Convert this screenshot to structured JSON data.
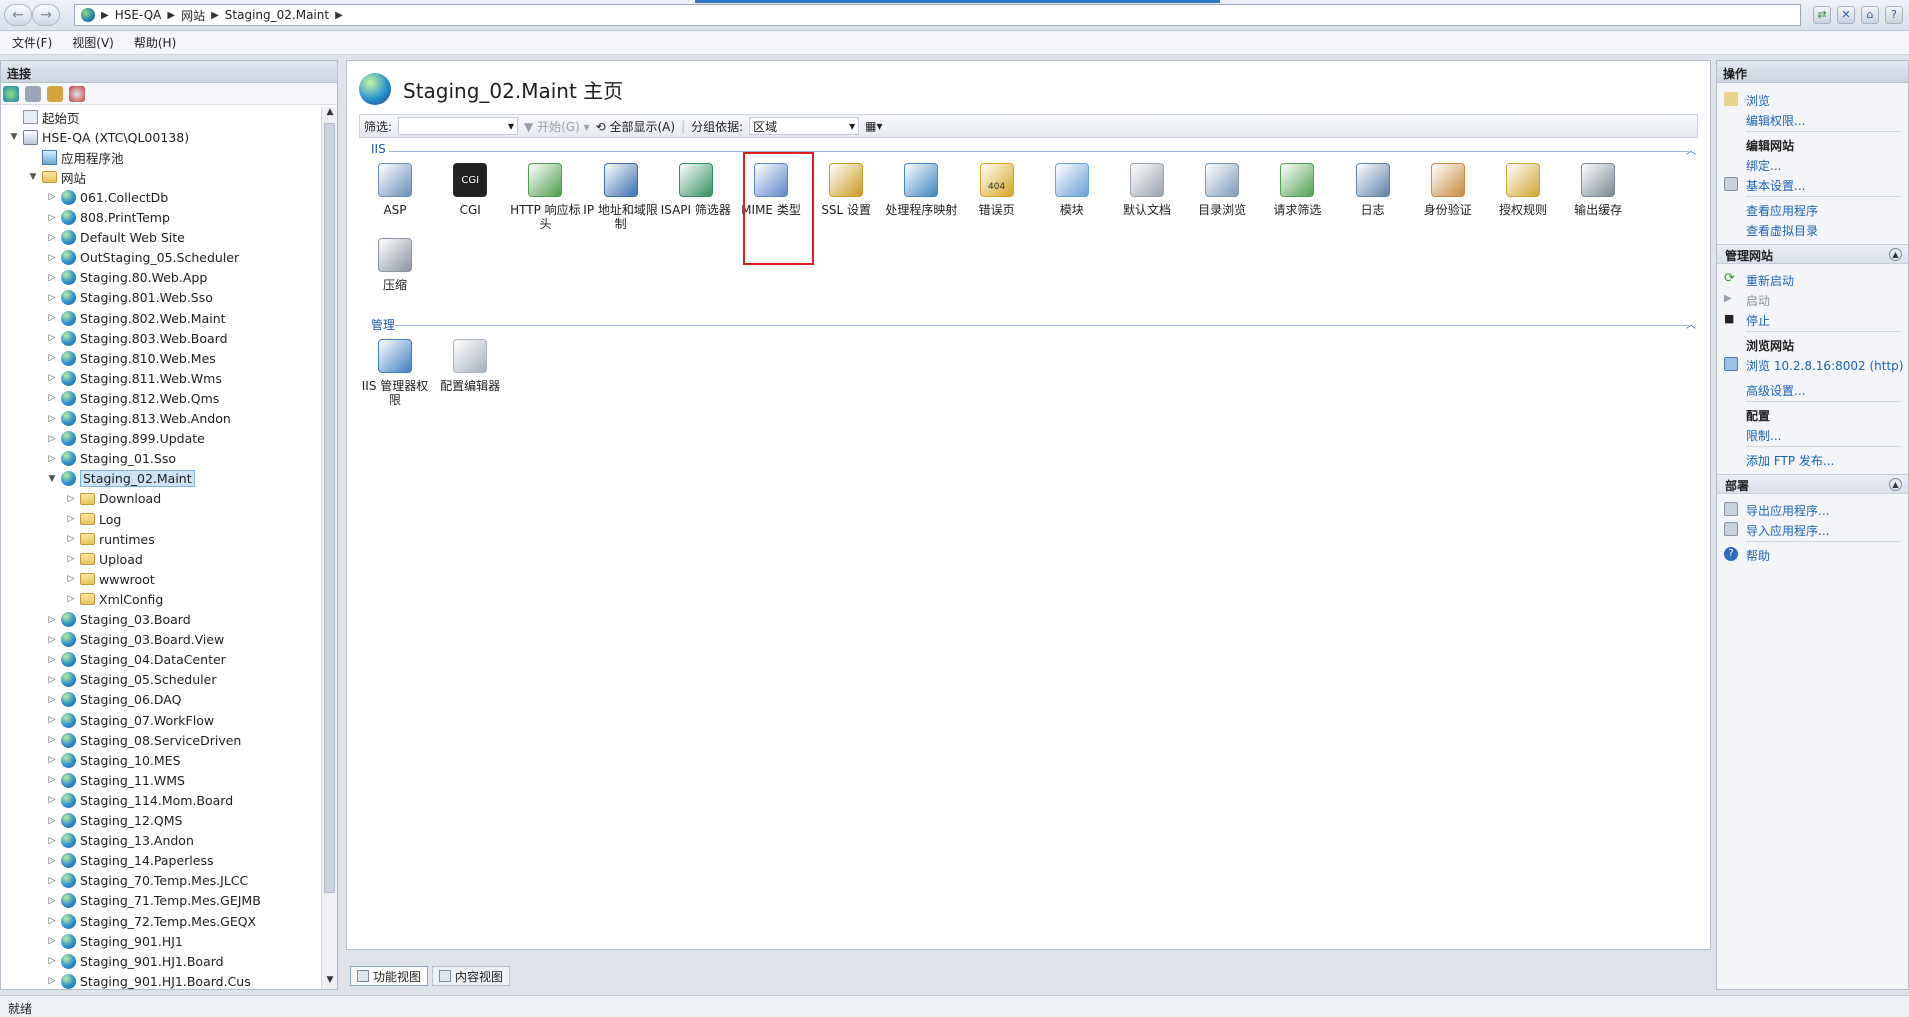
{
  "address": {
    "crumbs": [
      "HSE-QA",
      "网站",
      "Staging_02.Maint"
    ]
  },
  "menu": [
    "文件(F)",
    "视图(V)",
    "帮助(H)"
  ],
  "left": {
    "title": "连接",
    "tree": [
      {
        "label": "起始页",
        "indent": 0,
        "icon": "home",
        "tw": ""
      },
      {
        "label": "HSE-QA (XTC\\QL00138)",
        "indent": 0,
        "icon": "server",
        "tw": "▼"
      },
      {
        "label": "应用程序池",
        "indent": 1,
        "icon": "pool",
        "tw": ""
      },
      {
        "label": "网站",
        "indent": 1,
        "icon": "folder",
        "tw": "▼"
      },
      {
        "label": "061.CollectDb",
        "indent": 2,
        "icon": "globe",
        "tw": "▷"
      },
      {
        "label": "808.PrintTemp",
        "indent": 2,
        "icon": "globe",
        "tw": "▷"
      },
      {
        "label": "Default Web Site",
        "indent": 2,
        "icon": "globe",
        "tw": "▷"
      },
      {
        "label": "OutStaging_05.Scheduler",
        "indent": 2,
        "icon": "globe",
        "tw": "▷"
      },
      {
        "label": "Staging.80.Web.App",
        "indent": 2,
        "icon": "globe",
        "tw": "▷"
      },
      {
        "label": "Staging.801.Web.Sso",
        "indent": 2,
        "icon": "globe",
        "tw": "▷"
      },
      {
        "label": "Staging.802.Web.Maint",
        "indent": 2,
        "icon": "globe",
        "tw": "▷"
      },
      {
        "label": "Staging.803.Web.Board",
        "indent": 2,
        "icon": "globe",
        "tw": "▷"
      },
      {
        "label": "Staging.810.Web.Mes",
        "indent": 2,
        "icon": "globe",
        "tw": "▷"
      },
      {
        "label": "Staging.811.Web.Wms",
        "indent": 2,
        "icon": "globe",
        "tw": "▷"
      },
      {
        "label": "Staging.812.Web.Qms",
        "indent": 2,
        "icon": "globe",
        "tw": "▷"
      },
      {
        "label": "Staging.813.Web.Andon",
        "indent": 2,
        "icon": "globe",
        "tw": "▷"
      },
      {
        "label": "Staging.899.Update",
        "indent": 2,
        "icon": "globe",
        "tw": "▷"
      },
      {
        "label": "Staging_01.Sso",
        "indent": 2,
        "icon": "globe",
        "tw": "▷"
      },
      {
        "label": "Staging_02.Maint",
        "indent": 2,
        "icon": "globe",
        "tw": "▼",
        "selected": true
      },
      {
        "label": "Download",
        "indent": 3,
        "icon": "folder",
        "tw": "▷"
      },
      {
        "label": "Log",
        "indent": 3,
        "icon": "folder",
        "tw": "▷"
      },
      {
        "label": "runtimes",
        "indent": 3,
        "icon": "folder",
        "tw": "▷"
      },
      {
        "label": "Upload",
        "indent": 3,
        "icon": "folder",
        "tw": "▷"
      },
      {
        "label": "wwwroot",
        "indent": 3,
        "icon": "folder",
        "tw": "▷"
      },
      {
        "label": "XmlConfig",
        "indent": 3,
        "icon": "folder",
        "tw": "▷"
      },
      {
        "label": "Staging_03.Board",
        "indent": 2,
        "icon": "globe",
        "tw": "▷"
      },
      {
        "label": "Staging_03.Board.View",
        "indent": 2,
        "icon": "globe",
        "tw": "▷"
      },
      {
        "label": "Staging_04.DataCenter",
        "indent": 2,
        "icon": "globe",
        "tw": "▷"
      },
      {
        "label": "Staging_05.Scheduler",
        "indent": 2,
        "icon": "globe",
        "tw": "▷"
      },
      {
        "label": "Staging_06.DAQ",
        "indent": 2,
        "icon": "globe",
        "tw": "▷"
      },
      {
        "label": "Staging_07.WorkFlow",
        "indent": 2,
        "icon": "globe",
        "tw": "▷"
      },
      {
        "label": "Staging_08.ServiceDriven",
        "indent": 2,
        "icon": "globe",
        "tw": "▷"
      },
      {
        "label": "Staging_10.MES",
        "indent": 2,
        "icon": "globe",
        "tw": "▷"
      },
      {
        "label": "Staging_11.WMS",
        "indent": 2,
        "icon": "globe",
        "tw": "▷"
      },
      {
        "label": "Staging_114.Mom.Board",
        "indent": 2,
        "icon": "globe",
        "tw": "▷"
      },
      {
        "label": "Staging_12.QMS",
        "indent": 2,
        "icon": "globe",
        "tw": "▷"
      },
      {
        "label": "Staging_13.Andon",
        "indent": 2,
        "icon": "globe",
        "tw": "▷"
      },
      {
        "label": "Staging_14.Paperless",
        "indent": 2,
        "icon": "globe",
        "tw": "▷"
      },
      {
        "label": "Staging_70.Temp.Mes.JLCC",
        "indent": 2,
        "icon": "globe",
        "tw": "▷"
      },
      {
        "label": "Staging_71.Temp.Mes.GEJMB",
        "indent": 2,
        "icon": "globe",
        "tw": "▷"
      },
      {
        "label": "Staging_72.Temp.Mes.GEQX",
        "indent": 2,
        "icon": "globe",
        "tw": "▷"
      },
      {
        "label": "Staging_901.HJ1",
        "indent": 2,
        "icon": "globe",
        "tw": "▷"
      },
      {
        "label": "Staging_901.HJ1.Board",
        "indent": 2,
        "icon": "globe",
        "tw": "▷"
      },
      {
        "label": "Staging_901.HJ1.Board.Cus",
        "indent": 2,
        "icon": "globe",
        "tw": "▷"
      }
    ]
  },
  "center": {
    "title": "Staging_02.Maint 主页",
    "filter_label": "筛选:",
    "start_label": "开始(G)",
    "show_all_label": "全部显示(A)",
    "group_label": "分组依据:",
    "group_value": "区域",
    "iis_section": "IIS",
    "mgmt_section": "管理",
    "iis_features": [
      {
        "label": "ASP",
        "icon": "asp-icon",
        "color": "#6b8fb8"
      },
      {
        "label": "CGI",
        "icon": "cgi-icon",
        "color": "#2a2a2a"
      },
      {
        "label": "HTTP 响应标头",
        "icon": "http-headers-icon",
        "color": "#4f9e4f"
      },
      {
        "label": "IP 地址和域限制",
        "icon": "ip-restrictions-icon",
        "color": "#3a6fb0"
      },
      {
        "label": "ISAPI 筛选器",
        "icon": "isapi-filters-icon",
        "color": "#2f8f63"
      },
      {
        "label": "MIME 类型",
        "icon": "mime-types-icon",
        "color": "#5c86c9"
      },
      {
        "label": "SSL 设置",
        "icon": "ssl-lock-icon",
        "color": "#c99a1f"
      },
      {
        "label": "处理程序映射",
        "icon": "handler-mappings-icon",
        "color": "#3f86c2"
      },
      {
        "label": "错误页",
        "icon": "error-pages-icon",
        "color": "#d7a51e"
      },
      {
        "label": "模块",
        "icon": "modules-icon",
        "color": "#6aa0d6"
      },
      {
        "label": "默认文档",
        "icon": "default-document-icon",
        "color": "#9aa3ae"
      },
      {
        "label": "目录浏览",
        "icon": "directory-browsing-icon",
        "color": "#7f9bb8"
      },
      {
        "label": "请求筛选",
        "icon": "request-filtering-icon",
        "color": "#4fa04f"
      },
      {
        "label": "日志",
        "icon": "logging-icon",
        "color": "#5f7fa8"
      },
      {
        "label": "身份验证",
        "icon": "authentication-icon",
        "color": "#c98a3e"
      },
      {
        "label": "授权规则",
        "icon": "authorization-rules-icon",
        "color": "#d1a533"
      },
      {
        "label": "输出缓存",
        "icon": "output-caching-icon",
        "color": "#7a8796"
      },
      {
        "label": "压缩",
        "icon": "compression-icon",
        "color": "#8a94a0"
      }
    ],
    "mgmt_features": [
      {
        "label": "IIS 管理器权限",
        "icon": "iis-manager-permissions-icon",
        "color": "#3e7fc1"
      },
      {
        "label": "配置编辑器",
        "icon": "configuration-editor-icon",
        "color": "#a7b1bd"
      }
    ],
    "tabs": [
      "功能视图",
      "内容视图"
    ]
  },
  "right": {
    "title": "操作",
    "browse": "浏览",
    "edit_perms": "编辑权限...",
    "edit_site_header": "编辑网站",
    "bindings": "绑定...",
    "basic_settings": "基本设置...",
    "view_apps": "查看应用程序",
    "view_vdirs": "查看虚拟目录",
    "manage_site_header": "管理网站",
    "restart": "重新启动",
    "start": "启动",
    "stop": "停止",
    "browse_site_header": "浏览网站",
    "browse_url": "浏览 10.2.8.16:8002 (http)",
    "advanced_settings": "高级设置...",
    "config_header": "配置",
    "limits": "限制...",
    "add_ftp": "添加 FTP 发布...",
    "deploy_header": "部署",
    "export_app": "导出应用程序...",
    "import_app": "导入应用程序...",
    "help": "帮助"
  },
  "status": "就绪"
}
